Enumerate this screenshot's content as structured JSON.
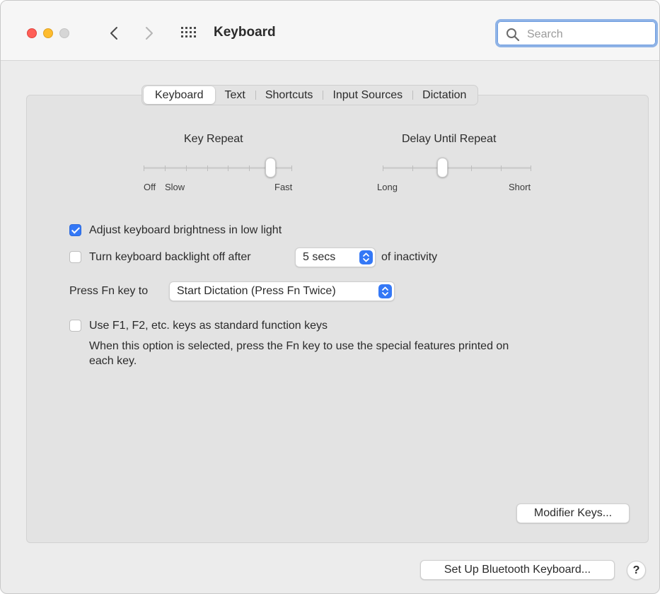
{
  "window": {
    "title": "Keyboard",
    "search_placeholder": "Search"
  },
  "tabs": [
    {
      "label": "Keyboard",
      "active": true
    },
    {
      "label": "Text",
      "active": false
    },
    {
      "label": "Shortcuts",
      "active": false
    },
    {
      "label": "Input Sources",
      "active": false
    },
    {
      "label": "Dictation",
      "active": false
    }
  ],
  "key_repeat": {
    "title": "Key Repeat",
    "left_label_1": "Off",
    "left_label_2": "Slow",
    "right_label": "Fast",
    "tick_count": 8,
    "selected_step": 6
  },
  "delay_until_repeat": {
    "title": "Delay Until Repeat",
    "left_label": "Long",
    "right_label": "Short",
    "tick_count": 6,
    "selected_step": 2
  },
  "options": {
    "adjust_brightness": {
      "label": "Adjust keyboard brightness in low light",
      "checked": true
    },
    "backlight_off": {
      "label": "Turn keyboard backlight off after",
      "checked": false,
      "duration": "5 secs",
      "suffix": "of inactivity"
    },
    "fn_key": {
      "label": "Press Fn key to",
      "value": "Start Dictation (Press Fn Twice)"
    },
    "function_keys": {
      "label": "Use F1, F2, etc. keys as standard function keys",
      "checked": false,
      "description_line1": "When this option is selected, press the Fn key to use the special features printed on",
      "description_line2": "each key."
    }
  },
  "buttons": {
    "modifier_keys": "Modifier Keys...",
    "bluetooth_keyboard": "Set Up Bluetooth Keyboard...",
    "help": "?"
  },
  "colors": {
    "accent": "#3478f6",
    "close": "#ff5f57",
    "minimize": "#febc2e",
    "zoom_inactive": "#d6d6d6"
  }
}
